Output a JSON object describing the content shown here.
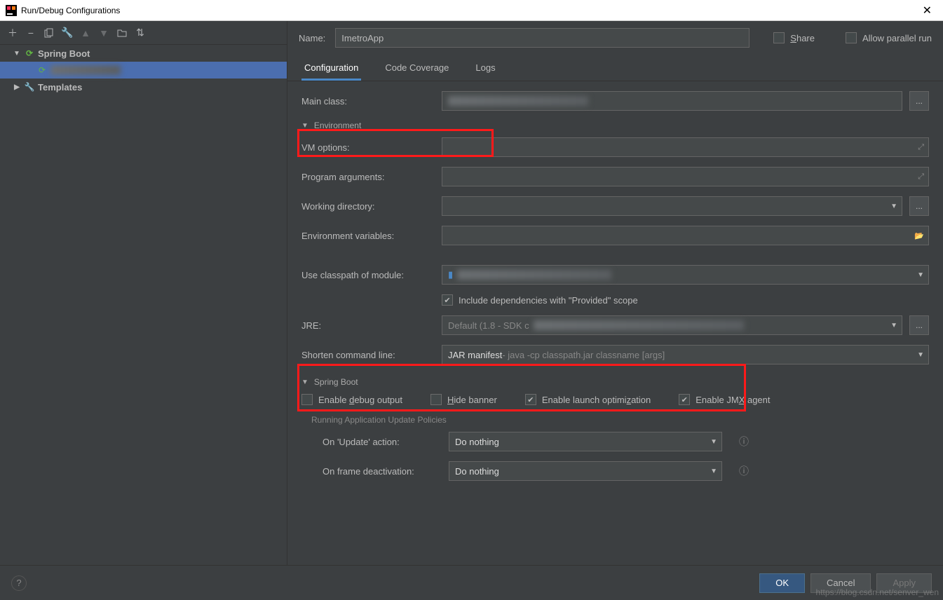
{
  "window": {
    "title": "Run/Debug Configurations"
  },
  "toolbar": {
    "add": "+",
    "remove": "−",
    "copy_icon": "copy",
    "edit_icon": "wrench",
    "up_icon": "▲",
    "down_icon": "▼",
    "folder_icon": "folder",
    "sort_icon": "sort"
  },
  "tree": {
    "spring_boot": {
      "label": "Spring Boot"
    },
    "selected_item": {
      "label": " "
    },
    "templates": {
      "label": "Templates"
    }
  },
  "top": {
    "name_label": "Name:",
    "name_value": "ImetroApp",
    "share_label": "Share",
    "allow_parallel_label": "Allow parallel run"
  },
  "tabs": {
    "configuration": "Configuration",
    "code_coverage": "Code Coverage",
    "logs": "Logs"
  },
  "form": {
    "main_class_label": "Main class:",
    "browse_btn": "...",
    "environment_section": "Environment",
    "vm_options_label": "VM options:",
    "program_arguments_label": "Program arguments:",
    "working_directory_label": "Working directory:",
    "env_vars_label": "Environment variables:",
    "use_classpath_label": "Use classpath of module:",
    "include_deps_label": "Include dependencies with \"Provided\" scope",
    "jre_label": "JRE:",
    "jre_value": "Default (1.8 - SDK c",
    "shorten_label": "Shorten command line:",
    "shorten_value_main": "JAR manifest",
    "shorten_value_sub": " - java -cp classpath.jar classname [args]",
    "spring_boot_section": "Spring Boot",
    "enable_debug_label": "Enable debug output",
    "hide_banner_label": "Hide banner",
    "enable_launch_opt_label": "Enable launch optimization",
    "enable_jmx_label": "Enable JMX agent",
    "running_policies_header": "Running Application Update Policies",
    "on_update_label": "On 'Update' action:",
    "on_update_value": "Do nothing",
    "on_frame_label": "On frame deactivation:",
    "on_frame_value": "Do nothing"
  },
  "footer": {
    "ok": "OK",
    "cancel": "Cancel",
    "apply": "Apply"
  },
  "watermark": "https://blog.csdn.net/senver_wen"
}
